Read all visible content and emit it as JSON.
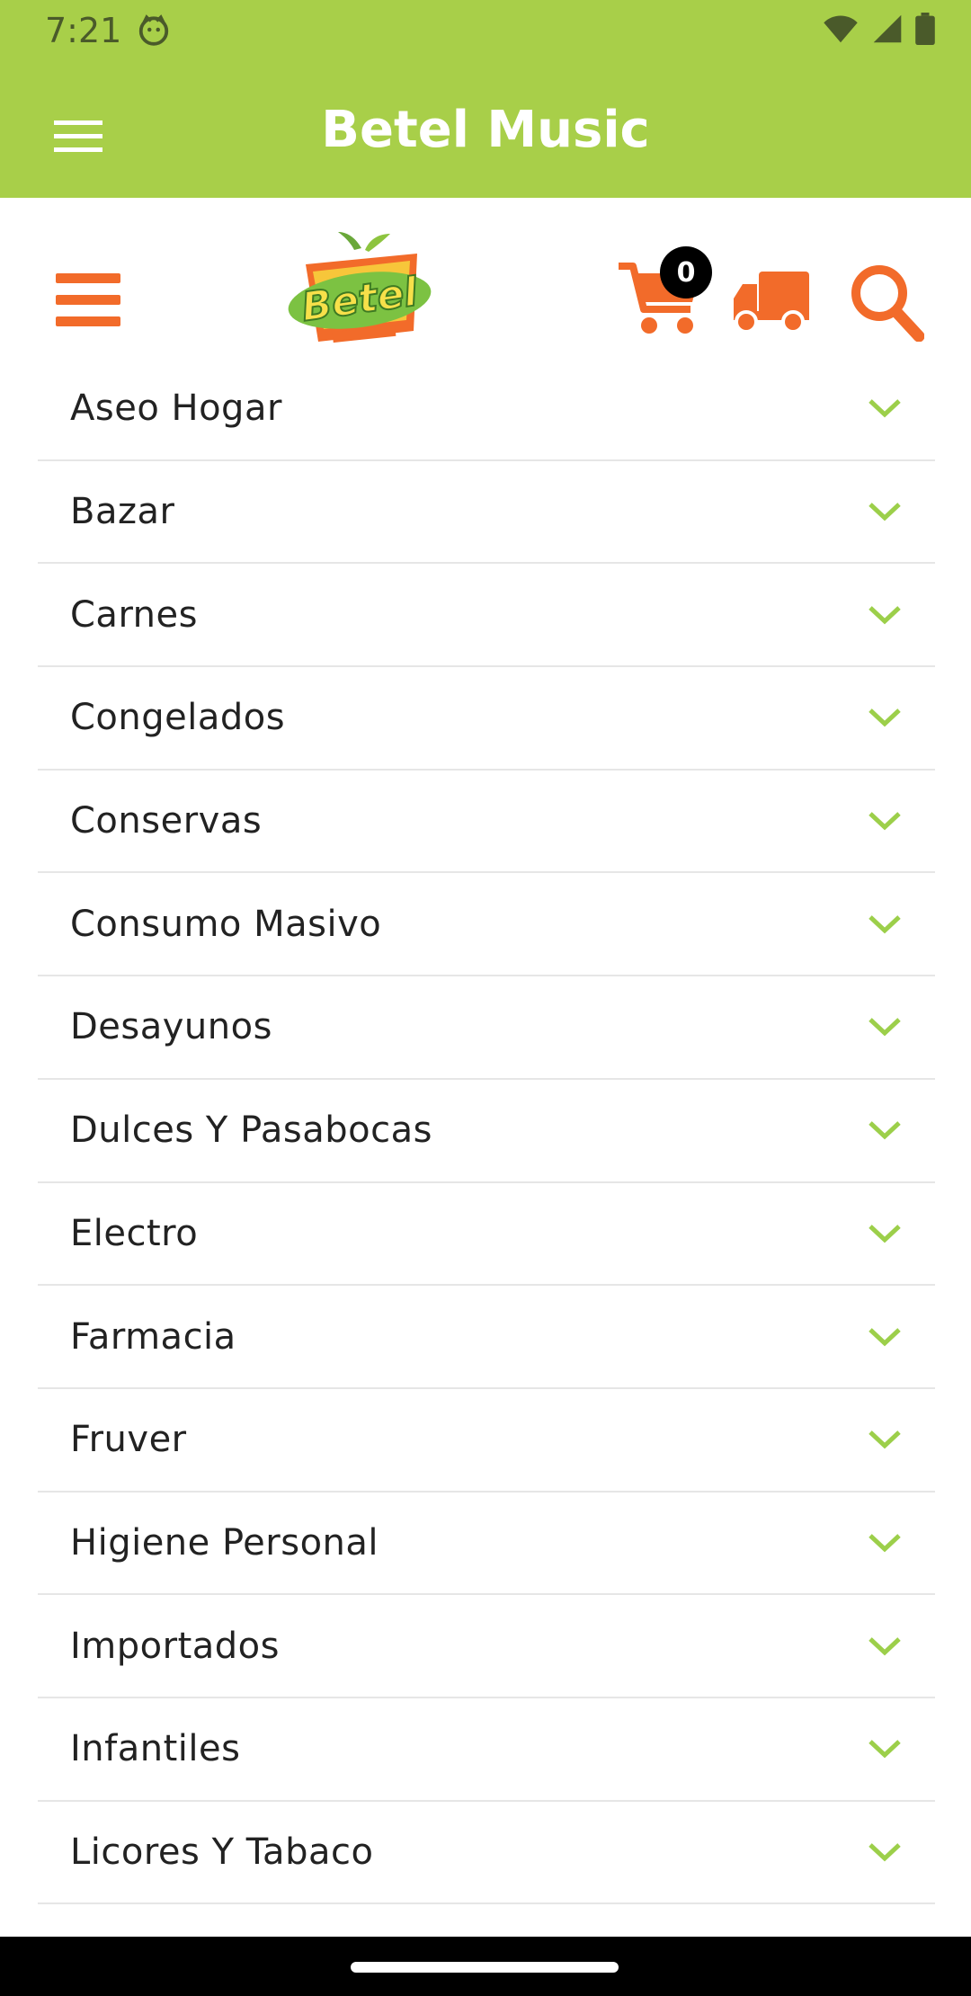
{
  "status_bar": {
    "time": "7:21",
    "icons": [
      "cat-icon",
      "wifi-icon",
      "signal-icon",
      "battery-icon"
    ]
  },
  "app_bar": {
    "title": "Betel Music",
    "menu_icon": "hamburger-menu-icon"
  },
  "header": {
    "cart_count": "0",
    "icons": [
      "hamburger-menu-icon",
      "cart-icon",
      "delivery-truck-icon",
      "search-icon"
    ],
    "logo_text": "Betel"
  },
  "categories": [
    "Aseo Hogar",
    "Bazar",
    "Carnes",
    "Congelados",
    "Conservas",
    "Consumo Masivo",
    "Desayunos",
    "Dulces Y Pasabocas",
    "Electro",
    "Farmacia",
    "Fruver",
    "Higiene Personal",
    "Importados",
    "Infantiles",
    "Licores Y Tabaco"
  ],
  "colors": {
    "app_bar": "#a8cf49",
    "accent_orange": "#f26b2a",
    "chevron_green": "#9ccf4a",
    "divider": "#e6e6e6"
  }
}
